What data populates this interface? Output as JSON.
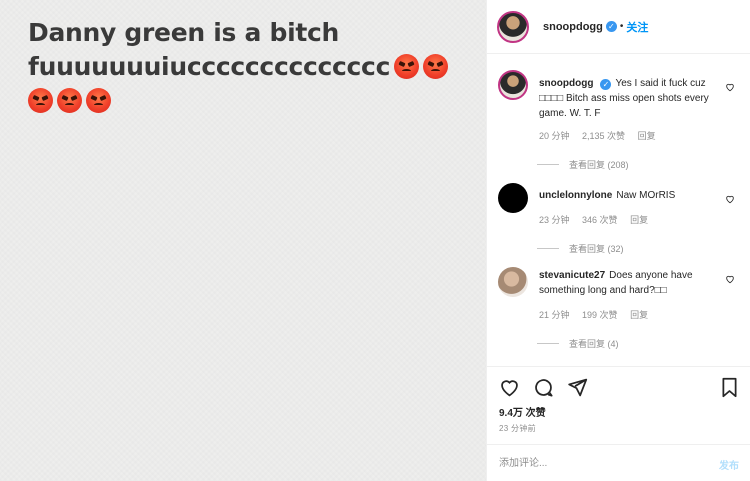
{
  "post": {
    "text_line1": "Danny green is a bitch",
    "text_line2": "fuuuuuuuiucccccccccccccc",
    "emoji": "angry-face",
    "emoji_count": 5
  },
  "header": {
    "username": "snoopdogg",
    "follow_label": "关注"
  },
  "comments": [
    {
      "user": "snoopdogg",
      "text": "Yes I said it fuck cuz □□□□ Bitch ass miss open shots every game. W. T. F",
      "time": "20 分钟",
      "likes": "2,135 次赞",
      "reply_label": "回复",
      "view_replies": "查看回复 (208)"
    },
    {
      "user": "unclelonnylone",
      "text": "Naw MOrRIS",
      "time": "23 分钟",
      "likes": "346 次赞",
      "reply_label": "回复",
      "view_replies": "查看回复 (32)"
    },
    {
      "user": "stevanicute27",
      "text": "Does anyone have something long and hard?□□",
      "time": "21 分钟",
      "likes": "199 次赞",
      "reply_label": "回复",
      "view_replies": "查看回复 (4)"
    }
  ],
  "actions": {
    "likes": "9.4万 次赞",
    "time_ago": "23 分钟前",
    "comment_placeholder": "添加评论...",
    "post_label": "发布"
  }
}
